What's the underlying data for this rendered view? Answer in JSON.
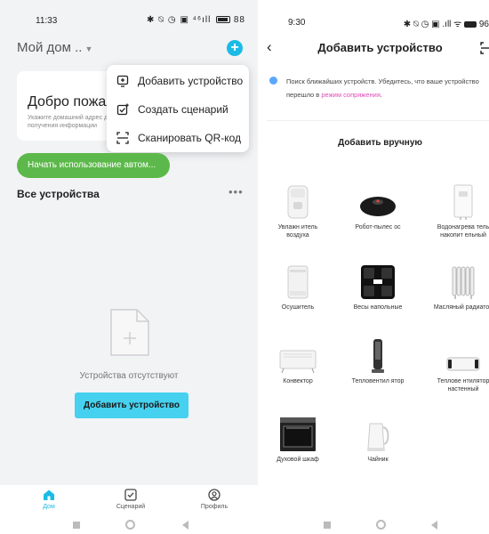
{
  "left": {
    "status": {
      "time": "11:33",
      "icons": "✱ ⍉ ◷ ▣ ⁴⁶ıll",
      "battery": "88"
    },
    "home_title": "Мой дом ..",
    "welcome": {
      "title": "Добро пожаловать",
      "subtitle": "Укажите домашний адрес для получения информации"
    },
    "dropdown": [
      {
        "label": "Добавить устройство",
        "icon": "add-device-icon"
      },
      {
        "label": "Создать сценарий",
        "icon": "create-scene-icon"
      },
      {
        "label": "Сканировать QR-код",
        "icon": "scan-qr-icon"
      }
    ],
    "start_button": "Начать использование автом...",
    "all_devices": "Все устройства",
    "more": "•••",
    "empty_text": "Устройства отсутствуют",
    "add_device_button": "Добавить устройство",
    "tabs": [
      {
        "label": "Дом",
        "icon": "home-icon",
        "active": true
      },
      {
        "label": "Сценарий",
        "icon": "scene-icon",
        "active": false
      },
      {
        "label": "Профиль",
        "icon": "profile-icon",
        "active": false
      }
    ],
    "accent": "#1bbbe6",
    "green": "#5cb84a"
  },
  "right": {
    "status": {
      "time": "9:30",
      "icons": "✱ ⍉ ◷ ▣ .ıll ᯤ",
      "battery": "96"
    },
    "title": "Добавить устройство",
    "search_text": "Поиск ближайших устройств. Убедитесь, что ваше устройство перешло в ",
    "search_link": "режим сопряжения",
    "search_end": ".",
    "manual_title": "Добавить вручную",
    "devices": [
      {
        "label": "Увлажн итель воздуха",
        "icon": "humidifier-icon"
      },
      {
        "label": "Робот-пылес ос",
        "icon": "robot-vacuum-icon"
      },
      {
        "label": "Водонагрева тель накопит ельный",
        "icon": "water-heater-icon"
      },
      {
        "label": "Осушитель",
        "icon": "dehumidifier-icon"
      },
      {
        "label": "Весы напольные",
        "icon": "scale-icon"
      },
      {
        "label": "Масляный радиатор",
        "icon": "oil-radiator-icon"
      },
      {
        "label": "Конвектор",
        "icon": "convector-icon"
      },
      {
        "label": "Тепловентил ятор",
        "icon": "fan-heater-icon"
      },
      {
        "label": "Теплове нтилятор настенный",
        "icon": "wall-heater-icon"
      },
      {
        "label": "Духовой шкаф",
        "icon": "oven-icon"
      },
      {
        "label": "Чайник",
        "icon": "kettle-icon"
      }
    ]
  }
}
